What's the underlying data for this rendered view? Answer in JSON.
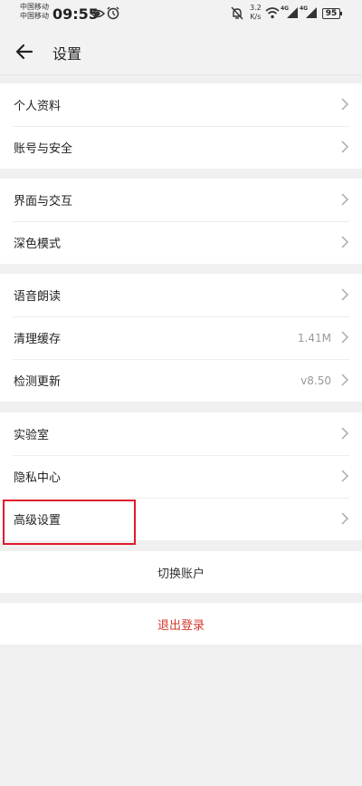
{
  "status_bar": {
    "carrier_top": "中国移动",
    "carrier_bottom": "中国移动",
    "time": "09:55",
    "net_speed_value": "3.2",
    "net_speed_unit": "K/s",
    "signal_tag_1": "4G",
    "signal_tag_2": "4G",
    "battery": "95",
    "icons": [
      "eye-icon",
      "alarm-icon",
      "mute-bell-icon",
      "wifi-icon",
      "signal-icon"
    ]
  },
  "header": {
    "title": "设置"
  },
  "groups": {
    "g1": [
      {
        "label": "个人资料"
      },
      {
        "label": "账号与安全"
      }
    ],
    "g2": [
      {
        "label": "界面与交互"
      },
      {
        "label": "深色模式"
      }
    ],
    "g3": [
      {
        "label": "语音朗读"
      },
      {
        "label": "清理缓存",
        "value": "1.41M"
      },
      {
        "label": "检测更新",
        "value": "v8.50"
      }
    ],
    "g4": [
      {
        "label": "实验室"
      },
      {
        "label": "隐私中心"
      },
      {
        "label": "高级设置"
      }
    ]
  },
  "actions": {
    "switch_account": "切换账户",
    "logout": "退出登录"
  },
  "colors": {
    "highlight": "#e0192d",
    "logout": "#d33a2f",
    "background": "#f0f0f0"
  }
}
